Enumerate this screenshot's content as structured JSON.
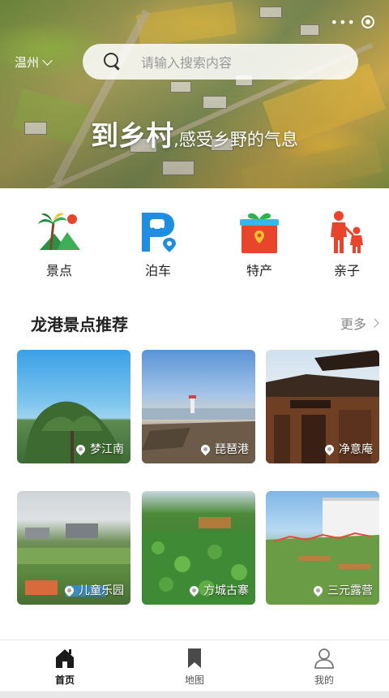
{
  "header": {
    "city": "温州",
    "search_placeholder": "请输入搜索内容",
    "capsule_more": "•••",
    "slogan_main": "到乡村",
    "slogan_sub": ",感受乡野的气息"
  },
  "categories": [
    {
      "label": "景点",
      "icon": "palm-tree-icon"
    },
    {
      "label": "泊车",
      "icon": "parking-icon"
    },
    {
      "label": "特产",
      "icon": "gift-box-icon"
    },
    {
      "label": "亲子",
      "icon": "parent-child-icon"
    }
  ],
  "section": {
    "title": "龙港景点推荐",
    "more_label": "更多"
  },
  "spots": [
    {
      "name": "梦江南"
    },
    {
      "name": "琵琶港"
    },
    {
      "name": "净意庵"
    },
    {
      "name": "儿童乐园"
    },
    {
      "name": "方城古寨"
    },
    {
      "name": "三元露营"
    }
  ],
  "tabbar": [
    {
      "label": "首页",
      "icon": "home-icon",
      "active": true
    },
    {
      "label": "地图",
      "icon": "bookmark-icon",
      "active": false
    },
    {
      "label": "我的",
      "icon": "user-icon",
      "active": false
    }
  ],
  "colors": {
    "accent_red": "#e8452c",
    "accent_blue": "#1e8fe0"
  }
}
